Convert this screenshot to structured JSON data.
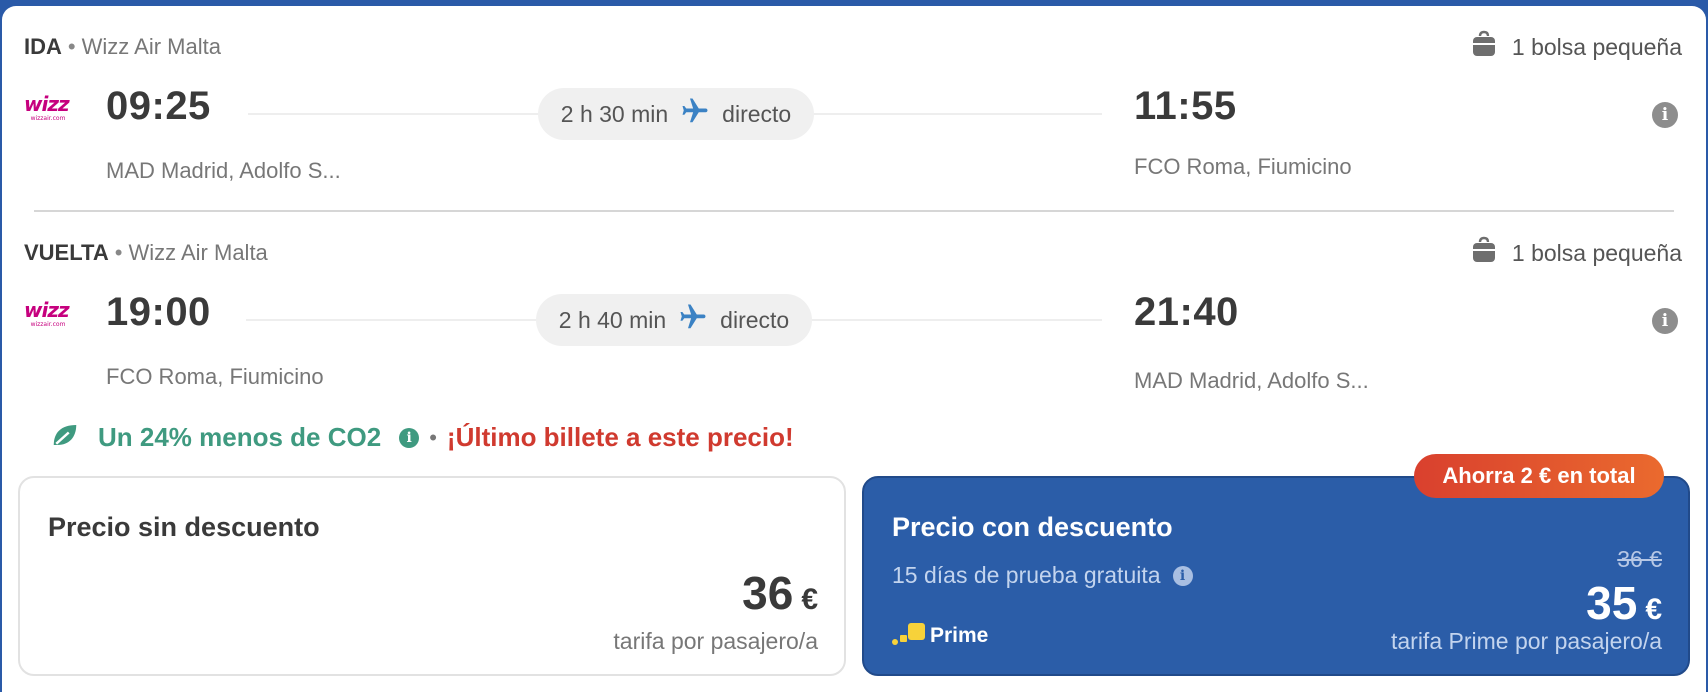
{
  "outbound": {
    "label": "IDA",
    "airline": "Wizz Air Malta",
    "baggage": "1 bolsa pequeña",
    "departure_time": "09:25",
    "arrival_time": "11:55",
    "duration": "2 h 30 min",
    "stops": "directo",
    "origin": "MAD Madrid, Adolfo S...",
    "destination": "FCO Roma, Fiumicino"
  },
  "return": {
    "label": "VUELTA",
    "airline": "Wizz Air Malta",
    "baggage": "1 bolsa pequeña",
    "departure_time": "19:00",
    "arrival_time": "21:40",
    "duration": "2 h 40 min",
    "stops": "directo",
    "origin": "FCO Roma, Fiumicino",
    "destination": "MAD Madrid, Adolfo S..."
  },
  "airline_logo_text": "wizz",
  "airline_logo_sub": "wizzair.com",
  "separator": "•",
  "co2_text": "Un 24% menos de CO2",
  "last_ticket_text": "¡Último billete a este precio!",
  "price_regular": {
    "title": "Precio sin descuento",
    "amount": "36",
    "currency": "€",
    "note": "tarifa por pasajero/a"
  },
  "price_prime": {
    "title": "Precio con descuento",
    "trial": "15 días de prueba gratuita",
    "old_price": "36 €",
    "amount": "35",
    "currency": "€",
    "note": "tarifa Prime por pasajero/a",
    "brand": "Prime",
    "savings_badge": "Ahorra 2 € en total"
  },
  "icons": {
    "baggage": "bag-icon",
    "plane": "plane-icon",
    "info": "info-icon",
    "leaf": "leaf-icon",
    "prime_logo": "prime-logo-icon"
  },
  "colors": {
    "brand_blue": "#2b5da8",
    "co2_green": "#3f9a80",
    "alert_red": "#d03a2f",
    "badge_orange": "#e55a2e",
    "plane_blue": "#3b82c4",
    "prime_yellow": "#f7d23a"
  }
}
